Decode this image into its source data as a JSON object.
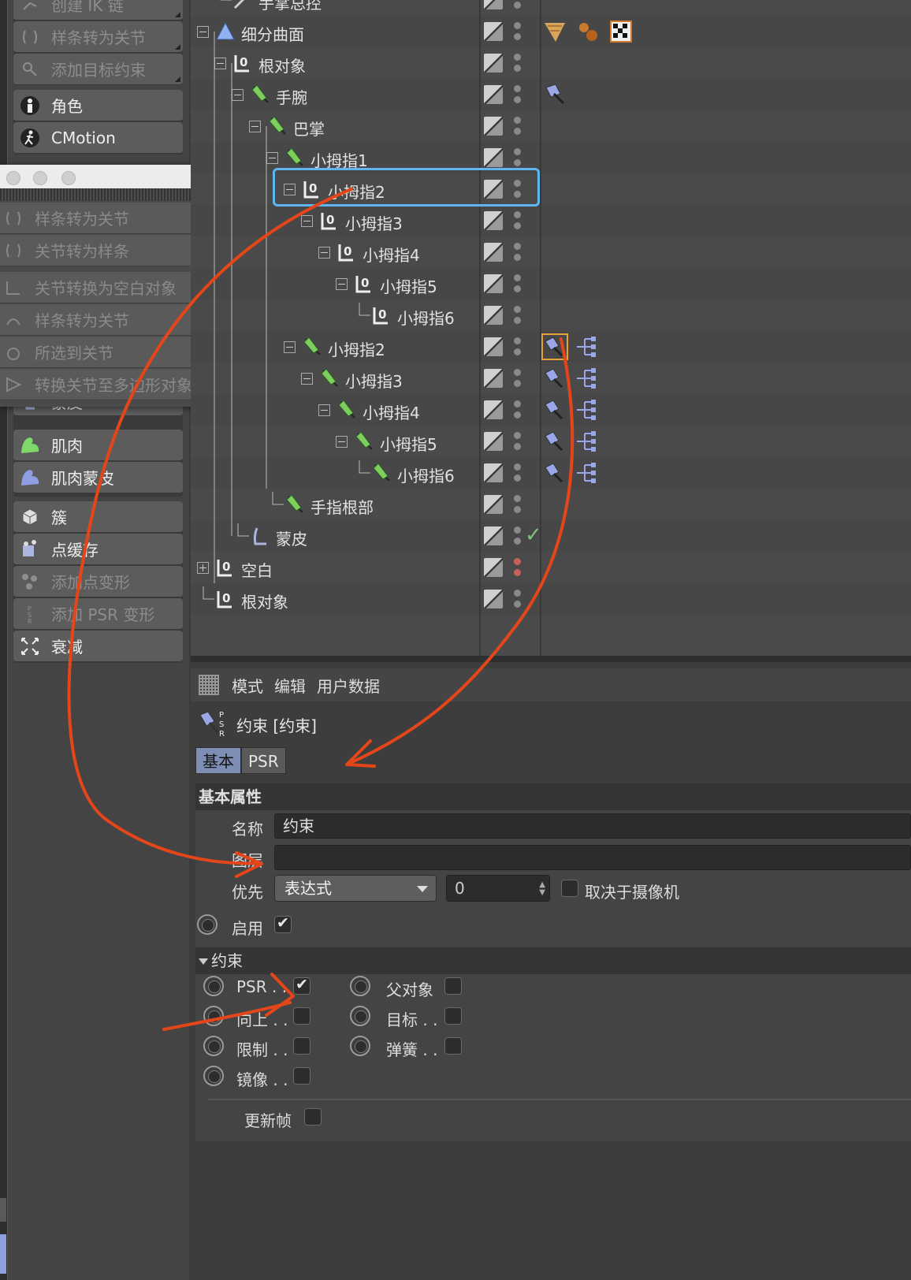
{
  "left_menu": {
    "items": [
      {
        "label": "创建 IK 链",
        "icon": "ik-chain-icon",
        "disabled": true
      },
      {
        "label": "样条转为关节",
        "icon": "spline-to-joint-icon",
        "disabled": true
      },
      {
        "label": "添加目标约束",
        "icon": "target-constraint-icon",
        "disabled": true
      },
      {
        "label": "角色",
        "icon": "character-icon",
        "disabled": false
      },
      {
        "label": "CMotion",
        "icon": "cmotion-icon",
        "disabled": false
      },
      {
        "label": "蒙皮",
        "icon": "skin-icon",
        "disabled": false
      },
      {
        "label": "肌肉",
        "icon": "muscle-icon",
        "disabled": false
      },
      {
        "label": "肌肉蒙皮",
        "icon": "muscle-skin-icon",
        "disabled": false
      },
      {
        "label": "簇",
        "icon": "cluster-icon",
        "disabled": false
      },
      {
        "label": "点缓存",
        "icon": "point-cache-icon",
        "disabled": false
      },
      {
        "label": "添加点变形",
        "icon": "point-morph-icon",
        "disabled": true
      },
      {
        "label": "添加 PSR 变形",
        "icon": "psr-morph-icon",
        "disabled": true
      },
      {
        "label": "衰减",
        "icon": "falloff-icon",
        "disabled": false
      }
    ]
  },
  "popup_menu": {
    "items": [
      {
        "label": "样条转为关节",
        "icon": "spline-to-joint-icon"
      },
      {
        "label": "关节转为样条",
        "icon": "joint-to-spline-icon"
      },
      {
        "label": "关节转换为空白对象",
        "icon": "joint-to-null-icon"
      },
      {
        "label": "样条转为关节",
        "icon": "spline-to-joint-icon"
      },
      {
        "label": "所选到关节",
        "icon": "selection-to-joint-icon"
      },
      {
        "label": "转换关节至多边形对象",
        "icon": "joint-to-polygon-icon"
      }
    ]
  },
  "object_manager": {
    "rows": [
      {
        "name": "手掌总控",
        "icon": "bone-icon",
        "depth": 1,
        "expand": "none"
      },
      {
        "name": "细分曲面",
        "icon": "subdivision-surface-icon",
        "depth": 0,
        "expand": "minus"
      },
      {
        "name": "根对象",
        "icon": "null-icon",
        "depth": 1,
        "expand": "minus"
      },
      {
        "name": "手腕",
        "icon": "joint-icon",
        "depth": 2,
        "expand": "minus"
      },
      {
        "name": "巴掌",
        "icon": "joint-icon",
        "depth": 3,
        "expand": "minus"
      },
      {
        "name": "小拇指1",
        "icon": "joint-icon",
        "depth": 4,
        "expand": "minus"
      },
      {
        "name": "小拇指2",
        "icon": "null-icon",
        "depth": 5,
        "expand": "minus"
      },
      {
        "name": "小拇指3",
        "icon": "null-icon",
        "depth": 6,
        "expand": "minus"
      },
      {
        "name": "小拇指4",
        "icon": "null-icon",
        "depth": 7,
        "expand": "minus"
      },
      {
        "name": "小拇指5",
        "icon": "null-icon",
        "depth": 8,
        "expand": "minus"
      },
      {
        "name": "小拇指6",
        "icon": "null-icon",
        "depth": 9,
        "expand": "none"
      },
      {
        "name": "小拇指2",
        "icon": "joint-icon",
        "depth": 5,
        "expand": "minus"
      },
      {
        "name": "小拇指3",
        "icon": "joint-icon",
        "depth": 6,
        "expand": "minus"
      },
      {
        "name": "小拇指4",
        "icon": "joint-icon",
        "depth": 7,
        "expand": "minus"
      },
      {
        "name": "小拇指5",
        "icon": "joint-icon",
        "depth": 8,
        "expand": "minus"
      },
      {
        "name": "小拇指6",
        "icon": "joint-icon",
        "depth": 9,
        "expand": "none"
      },
      {
        "name": "手指根部",
        "icon": "joint-icon",
        "depth": 4,
        "expand": "none"
      },
      {
        "name": "蒙皮",
        "icon": "skin-icon",
        "depth": 2,
        "expand": "none"
      },
      {
        "name": "空白",
        "icon": "null-icon",
        "depth": 0,
        "expand": "plus"
      },
      {
        "name": "根对象",
        "icon": "null-icon",
        "depth": 0,
        "expand": "none"
      }
    ]
  },
  "attributes": {
    "tabs": [
      "模式",
      "编辑",
      "用户数据"
    ],
    "object_title": "约束 [约束]",
    "subtabs": [
      "基本",
      "PSR"
    ],
    "section_basic": "基本属性",
    "name_label": "名称",
    "name_value": "约束",
    "layer_label": "图层",
    "layer_value": "",
    "priority_label": "优先",
    "priority_mode": "表达式",
    "priority_value": "0",
    "camera_label": "取决于摄像机",
    "enable_label": "启用",
    "section_constraint": "约束",
    "constraints_left": [
      {
        "label": "PSR . .",
        "checked": true
      },
      {
        "label": "向上 . .",
        "checked": false
      },
      {
        "label": "限制 . .",
        "checked": false
      },
      {
        "label": "镜像 . .",
        "checked": false
      }
    ],
    "constraints_right": [
      {
        "label": "父对象",
        "checked": false
      },
      {
        "label": "目标 . .",
        "checked": false
      },
      {
        "label": "弹簧 . .",
        "checked": false
      }
    ],
    "update_frame_label": "更新帧"
  },
  "colors": {
    "highlight_box": "#5fb6ef",
    "annotation_arrow": "#e4461a",
    "selected_tag": "#e8a23a",
    "active_subtab": "#7d8db4"
  }
}
